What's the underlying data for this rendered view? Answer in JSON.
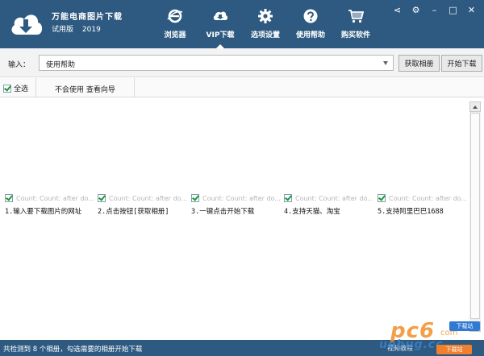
{
  "app": {
    "title": "万能电商图片下载",
    "edition": "试用版",
    "year": "2019"
  },
  "nav": [
    {
      "label": "浏览器",
      "icon": "browser-icon"
    },
    {
      "label": "VIP下载",
      "icon": "cloud-download-icon",
      "active": true
    },
    {
      "label": "选项设置",
      "icon": "gear-icon"
    },
    {
      "label": "使用帮助",
      "icon": "help-icon"
    },
    {
      "label": "购买软件",
      "icon": "cart-icon"
    }
  ],
  "window_controls": {
    "share": "⋖",
    "settings": "⚙",
    "minimize": "–",
    "maximize": "□",
    "close": "✕"
  },
  "input": {
    "label": "输入：",
    "value": "使用帮助",
    "get_album_button": "获取相册",
    "start_download_button": "开始下载"
  },
  "list_header": {
    "select_all": "全选",
    "guide_link": "不会使用 查看向导"
  },
  "cards": [
    {
      "count": "Count: Count: after do...",
      "step": "1.输入要下载图片的网址"
    },
    {
      "count": "Count: Count: after do...",
      "step": "2.点击按钮[获取相册]"
    },
    {
      "count": "Count: Count: after do...",
      "step": "3.一键点击开始下载"
    },
    {
      "count": "Count: Count: after do...",
      "step": "4.支持天猫、淘宝"
    },
    {
      "count": "Count: Count: after do...",
      "step": "5.支持阿里巴巴1688"
    }
  ],
  "status": {
    "text": "共检测到 8 个相册，勾选需要的相册开始下载",
    "right": "视频教程"
  },
  "watermark": {
    "big": "pc6",
    "com": "com",
    "domain": "uebug.cc",
    "badge_top": "下载站",
    "badge_bottom": "下载站"
  },
  "colors": {
    "header_bg": "#2e5a81",
    "accent_check": "#1b9a2e"
  }
}
